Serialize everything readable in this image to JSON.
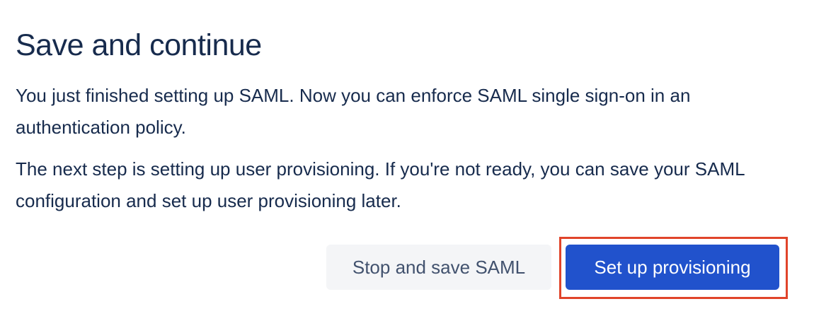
{
  "dialog": {
    "title": "Save and continue",
    "paragraph_1": "You just finished setting up SAML. Now you can enforce SAML single sign-on in an authentication policy.",
    "paragraph_2": "The next step is setting up user provisioning. If you're not ready, you can save your SAML configuration and set up user provisioning later."
  },
  "actions": {
    "secondary_label": "Stop and save SAML",
    "primary_label": "Set up provisioning"
  },
  "colors": {
    "text": "#172b4d",
    "primary_button": "#2152cc",
    "secondary_button": "#f4f5f7",
    "highlight_outline": "#e0442a"
  }
}
